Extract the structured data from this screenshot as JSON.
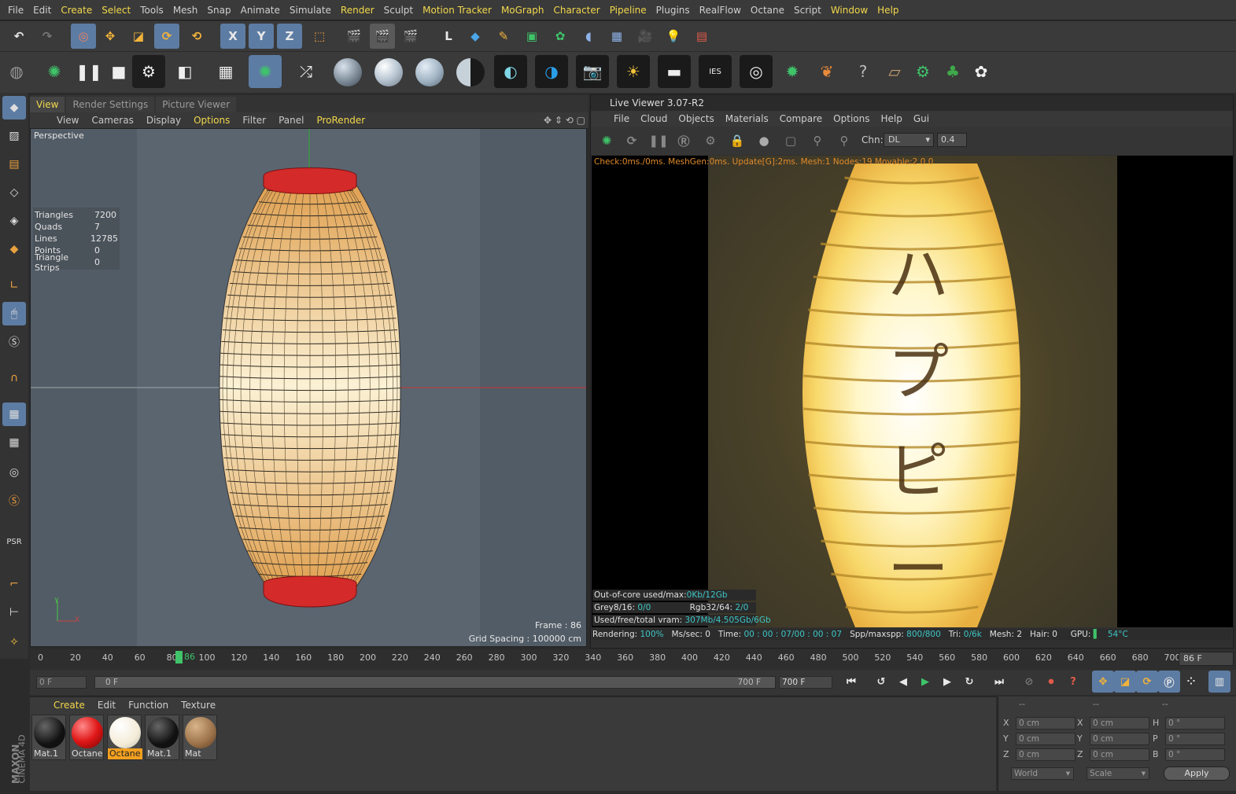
{
  "menubar": [
    "File",
    "Edit",
    "Create",
    "Select",
    "Tools",
    "Mesh",
    "Snap",
    "Animate",
    "Simulate",
    "Render",
    "Sculpt",
    "Motion Tracker",
    "MoGraph",
    "Character",
    "Pipeline",
    "Plugins",
    "RealFlow",
    "Octane",
    "Script",
    "Window",
    "Help"
  ],
  "menubar_highlight": [
    "Create",
    "Select",
    "Render",
    "Motion Tracker",
    "MoGraph",
    "Character",
    "Pipeline",
    "Window",
    "Help"
  ],
  "axis_buttons": [
    "X",
    "Y",
    "Z"
  ],
  "viewport_tabs": [
    "View",
    "Render Settings",
    "Picture Viewer"
  ],
  "viewport_menu": [
    "View",
    "Cameras",
    "Display",
    "Options",
    "Filter",
    "Panel",
    "ProRender"
  ],
  "viewport": {
    "label": "Perspective",
    "stats": [
      {
        "k": "Triangles",
        "v": "7200"
      },
      {
        "k": "Quads",
        "v": "7"
      },
      {
        "k": "Lines",
        "v": "12785"
      },
      {
        "k": "Points",
        "v": "0"
      },
      {
        "k": "Triangle Strips",
        "v": "0"
      }
    ],
    "frame_text": "Frame : 86",
    "grid_text": "Grid Spacing : 100000 cm",
    "axis_y": "Y",
    "axis_x": "X"
  },
  "liveviewer": {
    "title": "Live Viewer 3.07-R2",
    "menu": [
      "File",
      "Cloud",
      "Objects",
      "Materials",
      "Compare",
      "Options",
      "Help",
      "Gui"
    ],
    "chn_label": "Chn:",
    "chn_value": "DL",
    "chn_num": "0.4",
    "check_line": "Check:0ms./0ms. MeshGen:0ms. Update[G]:2ms. Mesh:1 Nodes:19 Movable:2  0 0",
    "ooc_label": "Out-of-core used/max:",
    "ooc_value": "0Kb/12Gb",
    "grey_label": "Grey8/16:",
    "grey_value": "0/0",
    "rgb_label": "Rgb32/64:",
    "rgb_value": "2/0",
    "vram_label": "Used/free/total vram:",
    "vram_value": "307Mb/4.505Gb/6Gb",
    "rendering_label": "Rendering:",
    "rendering_value": "100%",
    "ms_label": "Ms/sec:",
    "ms_value": "0",
    "time_label": "Time:",
    "time_value": "00 : 00 : 07/00 : 00 : 07",
    "spp_label": "Spp/maxspp:",
    "spp_value": "800/800",
    "tri_label": "Tri:",
    "tri_value": "0/6k",
    "mesh_label": "Mesh:",
    "mesh_value": "2",
    "hair_label": "Hair:",
    "hair_value": "0",
    "gpu_label": "GPU:",
    "gpu_temp": "54°C",
    "kana": [
      "ハ",
      "プ",
      "ピ",
      "ー"
    ]
  },
  "timeline": {
    "ticks": [
      "0",
      "20",
      "40",
      "60",
      "80",
      "100",
      "120",
      "140",
      "160",
      "180",
      "200",
      "220",
      "240",
      "260",
      "280",
      "300",
      "320",
      "340",
      "360",
      "380",
      "400",
      "420",
      "440",
      "460",
      "480",
      "500",
      "520",
      "540",
      "560",
      "580",
      "600",
      "620",
      "640",
      "660",
      "680",
      "700"
    ],
    "current": "86",
    "current_field": "86 F"
  },
  "transport": {
    "start_field": "0 F",
    "range_start": "0 F",
    "range_end": "700 F",
    "end_field": "700 F"
  },
  "materials": {
    "menu": [
      "Create",
      "Edit",
      "Function",
      "Texture"
    ],
    "items": [
      {
        "label": "Mat.1",
        "kind": "black"
      },
      {
        "label": "Octane",
        "kind": "red"
      },
      {
        "label": "Octane",
        "kind": "white",
        "selected": true
      },
      {
        "label": "Mat.1",
        "kind": "black"
      },
      {
        "label": "Mat",
        "kind": "wood"
      }
    ]
  },
  "coords": {
    "header1": "--",
    "header2": "--",
    "header3": "--",
    "rows": [
      {
        "a": "X",
        "av": "0 cm",
        "b": "X",
        "bv": "0 cm",
        "c": "H",
        "cv": "0 °"
      },
      {
        "a": "Y",
        "av": "0 cm",
        "b": "Y",
        "bv": "0 cm",
        "c": "P",
        "cv": "0 °"
      },
      {
        "a": "Z",
        "av": "0 cm",
        "b": "Z",
        "bv": "0 cm",
        "c": "B",
        "cv": "0 °"
      }
    ],
    "world": "World",
    "scale": "Scale",
    "apply": "Apply"
  },
  "brand_line1": "MAXON",
  "brand_line2": "CINEMA 4D"
}
